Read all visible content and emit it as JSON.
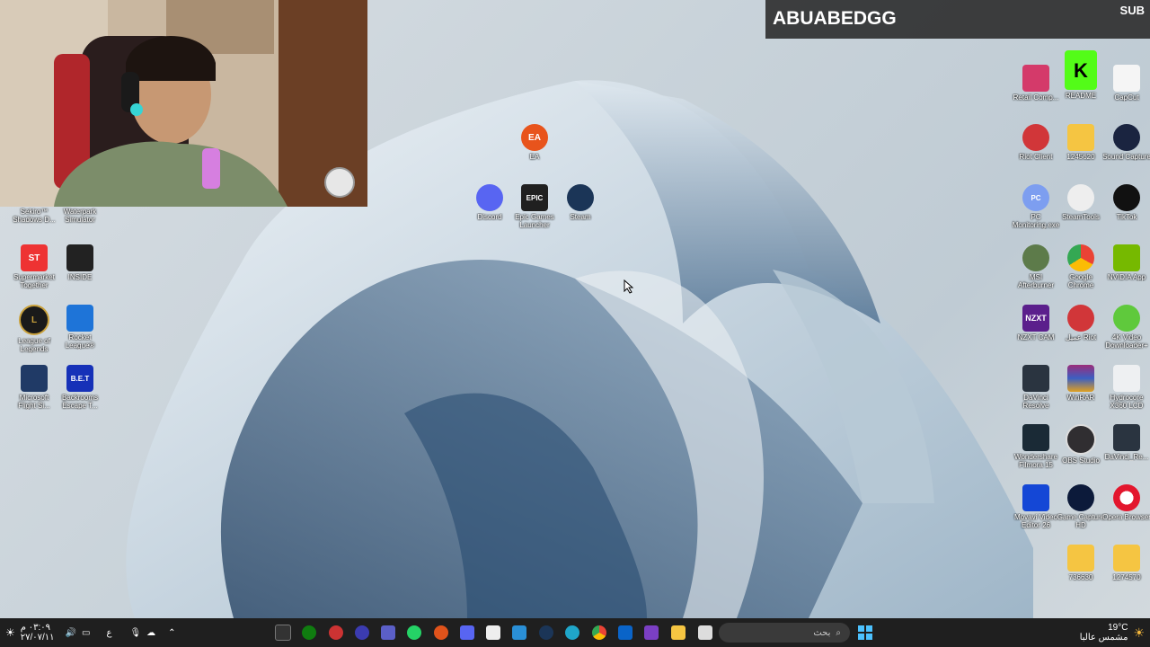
{
  "overlay": {
    "streamer_name": "ABUABEDGG",
    "sub_text": "SUB"
  },
  "desktop_icons": [
    {
      "key": "sekiro",
      "label": "Sekiro™ Shadows D...",
      "icon": "sekiro-icon"
    },
    {
      "key": "waterpark",
      "label": "Waterpark Simulator",
      "icon": "waterpark-icon"
    },
    {
      "key": "supermarket",
      "label": "Supermarket Together",
      "icon": "supermarket-icon",
      "glyph": "ST"
    },
    {
      "key": "inside",
      "label": "INSIDE",
      "icon": "inside-icon"
    },
    {
      "key": "lol",
      "label": "League of Legends",
      "icon": "league-of-legends-icon",
      "glyph": "L"
    },
    {
      "key": "rocket",
      "label": "Rocket League®",
      "icon": "rocket-league-icon"
    },
    {
      "key": "msfs",
      "label": "Microsoft Flight Si...",
      "icon": "flight-simulator-icon"
    },
    {
      "key": "backrooms",
      "label": "Backrooms Escape T...",
      "icon": "backrooms-icon",
      "glyph": "B.E.T"
    },
    {
      "key": "ea",
      "label": "EA",
      "icon": "ea-icon",
      "glyph": "EA"
    },
    {
      "key": "discord",
      "label": "Discord",
      "icon": "discord-icon"
    },
    {
      "key": "epic",
      "label": "Epic Games Launcher",
      "icon": "epic-games-icon",
      "glyph": "EPIC"
    },
    {
      "key": "steam",
      "label": "Steam",
      "icon": "steam-icon"
    },
    {
      "key": "retail",
      "label": "Retail Comp...",
      "icon": "retail-icon"
    },
    {
      "key": "readme",
      "label": "README",
      "icon": "readme-icon",
      "glyph": "K"
    },
    {
      "key": "capcut",
      "label": "CapCut",
      "icon": "capcut-icon"
    },
    {
      "key": "riot",
      "label": "Riot Client",
      "icon": "riot-client-icon"
    },
    {
      "key": "folder1",
      "label": "1245620",
      "icon": "folder-icon"
    },
    {
      "key": "soundcap",
      "label": "Sound Capture",
      "icon": "sound-capture-icon"
    },
    {
      "key": "pcmon",
      "label": "PC Monitoring.exe",
      "icon": "pc-monitoring-icon",
      "glyph": "PC"
    },
    {
      "key": "steamtools",
      "label": "SteamTools",
      "icon": "steamtools-icon"
    },
    {
      "key": "tiktok",
      "label": "TikTok",
      "icon": "tiktok-icon"
    },
    {
      "key": "msiab",
      "label": "MSI Afterburner",
      "icon": "msi-afterburner-icon"
    },
    {
      "key": "chrome",
      "label": "Google Chrome",
      "icon": "chrome-icon"
    },
    {
      "key": "nvidia",
      "label": "NVIDIA App",
      "icon": "nvidia-icon"
    },
    {
      "key": "nzxt",
      "label": "NZXT CAM",
      "icon": "nzxt-icon",
      "glyph": "NZXT"
    },
    {
      "key": "riotar",
      "label": "عميل Riot",
      "icon": "riot-icon"
    },
    {
      "key": "4kvid",
      "label": "4K Video Downloader+",
      "icon": "4k-downloader-icon"
    },
    {
      "key": "davinci",
      "label": "DaVinci Resolve",
      "icon": "davinci-icon"
    },
    {
      "key": "winrar",
      "label": "WinRAR",
      "icon": "winrar-icon"
    },
    {
      "key": "hydro",
      "label": "Hydrocore X360 LCD",
      "icon": "hydrocore-icon"
    },
    {
      "key": "filmora",
      "label": "Wondershare Filmora 15",
      "icon": "filmora-icon"
    },
    {
      "key": "obs",
      "label": "OBS Studio",
      "icon": "obs-icon"
    },
    {
      "key": "davinci2",
      "label": "DaVinci_Re...",
      "icon": "davinci-icon"
    },
    {
      "key": "movavi",
      "label": "Movavi Video Editor 26",
      "icon": "movavi-icon"
    },
    {
      "key": "gamecap",
      "label": "Game Capture HD",
      "icon": "game-capture-icon"
    },
    {
      "key": "opera",
      "label": "Opera Browser",
      "icon": "opera-icon"
    },
    {
      "key": "folder2",
      "label": "736630",
      "icon": "folder-icon"
    },
    {
      "key": "folder3",
      "label": "1274570",
      "icon": "folder-icon"
    }
  ],
  "taskbar": {
    "search_placeholder": "بحث",
    "weather_temp": "19°C",
    "weather_desc": "مشمس عالبا",
    "clock_time": "٠٣:٠٩ م",
    "clock_date": "٢٧/٠٧/١١",
    "lang": "ع"
  }
}
